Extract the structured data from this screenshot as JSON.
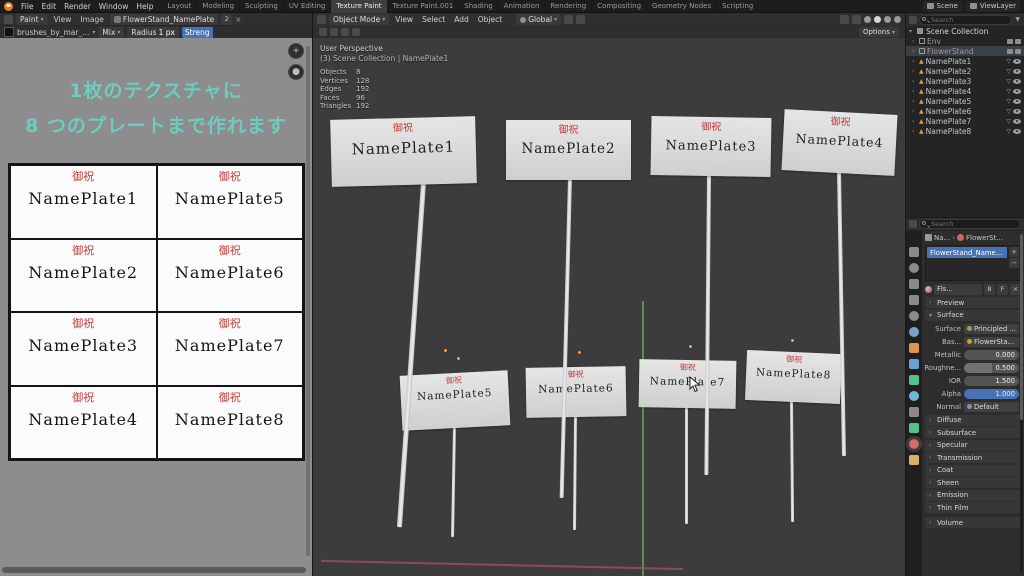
{
  "colors": {
    "accent_blue": "#4772b3",
    "caption_teal": "#6cccc0",
    "celebration_red": "#c23b3b",
    "object_orange": "#e0954f",
    "mesh_green": "#62c493"
  },
  "topbar": {
    "menus": [
      "File",
      "Edit",
      "Render",
      "Window",
      "Help"
    ],
    "workspaces": [
      "Layout",
      "Modeling",
      "Sculpting",
      "UV Editing",
      "Texture Paint",
      "Texture Paint.001",
      "Shading",
      "Animation",
      "Rendering",
      "Compositing",
      "Geometry Nodes",
      "Scripting"
    ],
    "active_workspace": "Texture Paint",
    "scene_label": "Scene",
    "view_layer_label": "ViewLayer"
  },
  "image_editor": {
    "mode": "Paint",
    "menus": [
      "View",
      "Image"
    ],
    "datablock": "FlowerStand_NamePlate",
    "datablock_users": "2",
    "unlink": "×",
    "brush_name": "brushes_by_mar_...",
    "blend_mode": "Mix",
    "radius_label": "Radius",
    "radius_value": "1 px",
    "strength_label": "Streng",
    "caption_line1": "1枚のテクスチャに",
    "caption_line2": "8 つのプレートまで作れます",
    "celebration": "御祝",
    "grid": [
      [
        "NamePlate1",
        "NamePlate5"
      ],
      [
        "NamePlate2",
        "NamePlate6"
      ],
      [
        "NamePlate3",
        "NamePlate7"
      ],
      [
        "NamePlate4",
        "NamePlate8"
      ]
    ]
  },
  "viewport": {
    "mode": "Object Mode",
    "menus": [
      "View",
      "Select",
      "Add",
      "Object"
    ],
    "orientation": "Global",
    "options_label": "Options",
    "celebration": "御祝",
    "overlay": {
      "perspective": "User Perspective",
      "context": "(3) Scene Collection | NamePlate1",
      "stats": [
        {
          "label": "Objects",
          "value": "8"
        },
        {
          "label": "Vertices",
          "value": "128"
        },
        {
          "label": "Edges",
          "value": "192"
        },
        {
          "label": "Faces",
          "value": "96"
        },
        {
          "label": "Triangles",
          "value": "192"
        }
      ]
    },
    "plates_front": [
      "NamePlate1",
      "NamePlate2",
      "NamePlate3",
      "NamePlate4"
    ],
    "plates_back": [
      "NamePlate5",
      "NamePlate6",
      "NamePlate7",
      "NamePlate8"
    ]
  },
  "outliner": {
    "search_placeholder": "Search",
    "root": "Scene Collection",
    "items": [
      {
        "label": "Env"
      },
      {
        "label": "FlowerStand"
      },
      {
        "label": "NamePlate1"
      },
      {
        "label": "NamePlate2"
      },
      {
        "label": "NamePlate3"
      },
      {
        "label": "NamePlate4"
      },
      {
        "label": "NamePlate5"
      },
      {
        "label": "NamePlate6"
      },
      {
        "label": "NamePlate7"
      },
      {
        "label": "NamePlate8"
      }
    ]
  },
  "properties": {
    "search_placeholder": "Search",
    "breadcrumb": {
      "object": "Na...",
      "separator": "›",
      "material": "FlowerSt..."
    },
    "slot_selected": "FlowerStand_Name...",
    "slot_add": "+",
    "slot_remove": "−",
    "material_field": "Fls...",
    "material_users": "8",
    "fake_user": "F",
    "unlink": "×",
    "preview_label": "Preview",
    "surface_label": "Surface",
    "rows": [
      {
        "label": "Surface",
        "value": "Principled ..."
      },
      {
        "label": "Bas...",
        "value": "FlowerSta..."
      },
      {
        "label": "Metallic",
        "value": "0.000"
      },
      {
        "label": "Roughne...",
        "value": "0.500"
      },
      {
        "label": "IOR",
        "value": "1.500"
      },
      {
        "label": "Alpha",
        "value": "1.000"
      },
      {
        "label": "Normal",
        "value": "Default"
      }
    ],
    "collapsed": [
      "Diffuse",
      "Subsurface",
      "Specular",
      "Transmission",
      "Coat",
      "Sheen",
      "Emission",
      "Thin Film",
      "Volume"
    ]
  }
}
